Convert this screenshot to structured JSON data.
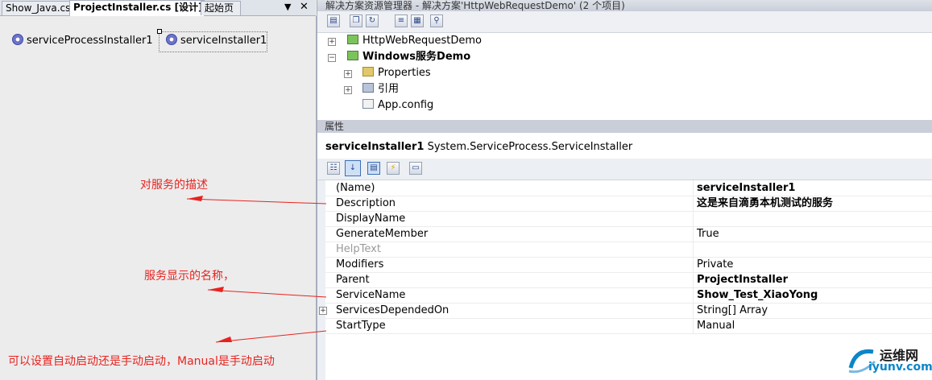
{
  "tabs": [
    {
      "label": "Show_Java.cs",
      "active": false
    },
    {
      "label": "ProjectInstaller.cs [设计]*",
      "active": true
    },
    {
      "label": "起始页",
      "active": false
    }
  ],
  "tab_controls": {
    "dropdown": "▼",
    "close": "✕"
  },
  "designer": {
    "components": [
      {
        "label": "serviceProcessInstaller1",
        "icon": "gear-icon"
      },
      {
        "label": "serviceInstaller1",
        "icon": "gear-icon",
        "selected": true
      }
    ]
  },
  "solution_explorer": {
    "title": "解决方案资源管理器 - 解决方案'HttpWebRequestDemo' (2 个项目)",
    "items": [
      {
        "label": "HttpWebRequestDemo",
        "bold": false,
        "expander": "+",
        "icon": "csharp-project-icon"
      },
      {
        "label": "Windows服务Demo",
        "bold": true,
        "expander": "−",
        "icon": "csharp-project-icon"
      },
      {
        "label": "Properties",
        "bold": false,
        "expander": "+",
        "icon": "properties-folder-icon"
      },
      {
        "label": "引用",
        "bold": false,
        "expander": "+",
        "icon": "references-icon"
      },
      {
        "label": "App.config",
        "bold": false,
        "expander": "",
        "icon": "config-file-icon"
      }
    ]
  },
  "properties": {
    "header": "属性",
    "object_name": "serviceInstaller1",
    "object_type": "System.ServiceProcess.ServiceInstaller",
    "rows": [
      {
        "name": "(Name)",
        "value": "serviceInstaller1",
        "bold": true,
        "gray": false,
        "expandable": false
      },
      {
        "name": "Description",
        "value": "这是来自滴勇本机测试的服务",
        "bold": true,
        "gray": false,
        "expandable": false
      },
      {
        "name": "DisplayName",
        "value": "",
        "bold": false,
        "gray": false,
        "expandable": false
      },
      {
        "name": "GenerateMember",
        "value": "True",
        "bold": false,
        "gray": false,
        "expandable": false
      },
      {
        "name": "HelpText",
        "value": "",
        "bold": false,
        "gray": true,
        "expandable": false
      },
      {
        "name": "Modifiers",
        "value": "Private",
        "bold": false,
        "gray": false,
        "expandable": false
      },
      {
        "name": "Parent",
        "value": "ProjectInstaller",
        "bold": true,
        "gray": false,
        "expandable": false
      },
      {
        "name": "ServiceName",
        "value": "Show_Test_XiaoYong",
        "bold": true,
        "gray": false,
        "expandable": false
      },
      {
        "name": "ServicesDependedOn",
        "value": "String[] Array",
        "bold": false,
        "gray": false,
        "expandable": true
      },
      {
        "name": "StartType",
        "value": "Manual",
        "bold": false,
        "gray": false,
        "expandable": false
      }
    ]
  },
  "annotations": [
    {
      "text": "对服务的描述"
    },
    {
      "text": "服务显示的名称，"
    },
    {
      "text": "可以设置自动启动还是手动启动，Manual是手动启动"
    }
  ],
  "colors": {
    "annotation": "#e8231f",
    "logo_blue": "#0a86c9"
  },
  "watermark": {
    "line1": "运维网",
    "line2": "iyunv.com"
  }
}
